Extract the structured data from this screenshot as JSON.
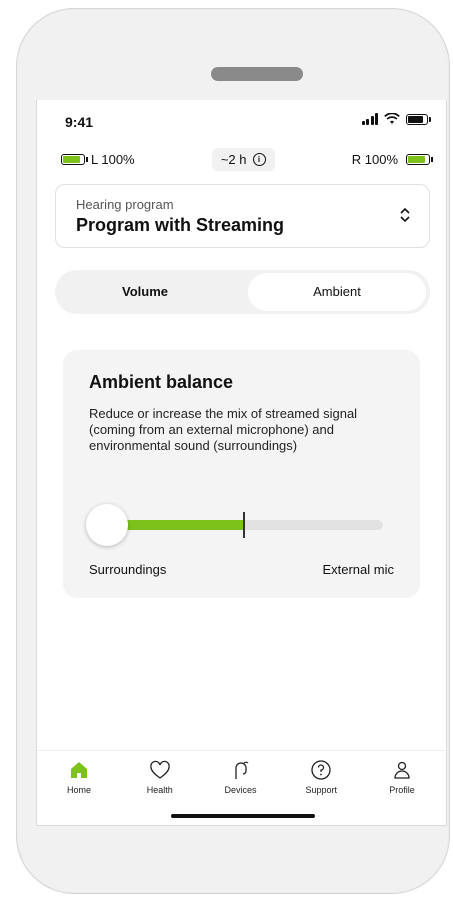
{
  "status_bar": {
    "time": "9:41"
  },
  "batteries": {
    "left": "L 100%",
    "duration": "~2 h",
    "right": "R 100%"
  },
  "program": {
    "label": "Hearing program",
    "name": "Program with Streaming"
  },
  "tabs": [
    {
      "label": "Volume",
      "selected": false
    },
    {
      "label": "Ambient",
      "selected": true
    }
  ],
  "ambient": {
    "title": "Ambient balance",
    "description": "Reduce or increase the mix of streamed signal (coming from an external microphone) and environmental sound (surroundings)",
    "slider": {
      "min_label": "Surroundings",
      "max_label": "External mic",
      "value": 0.0,
      "center": 0.5
    }
  },
  "nav": [
    {
      "label": "Home",
      "icon": "home-icon",
      "active": true
    },
    {
      "label": "Health",
      "icon": "heart-icon",
      "active": false
    },
    {
      "label": "Devices",
      "icon": "hearing-aid-icon",
      "active": false
    },
    {
      "label": "Support",
      "icon": "question-icon",
      "active": false
    },
    {
      "label": "Profile",
      "icon": "person-icon",
      "active": false
    }
  ],
  "colors": {
    "accent": "#7cc21a",
    "card": "#f4f4f4"
  }
}
